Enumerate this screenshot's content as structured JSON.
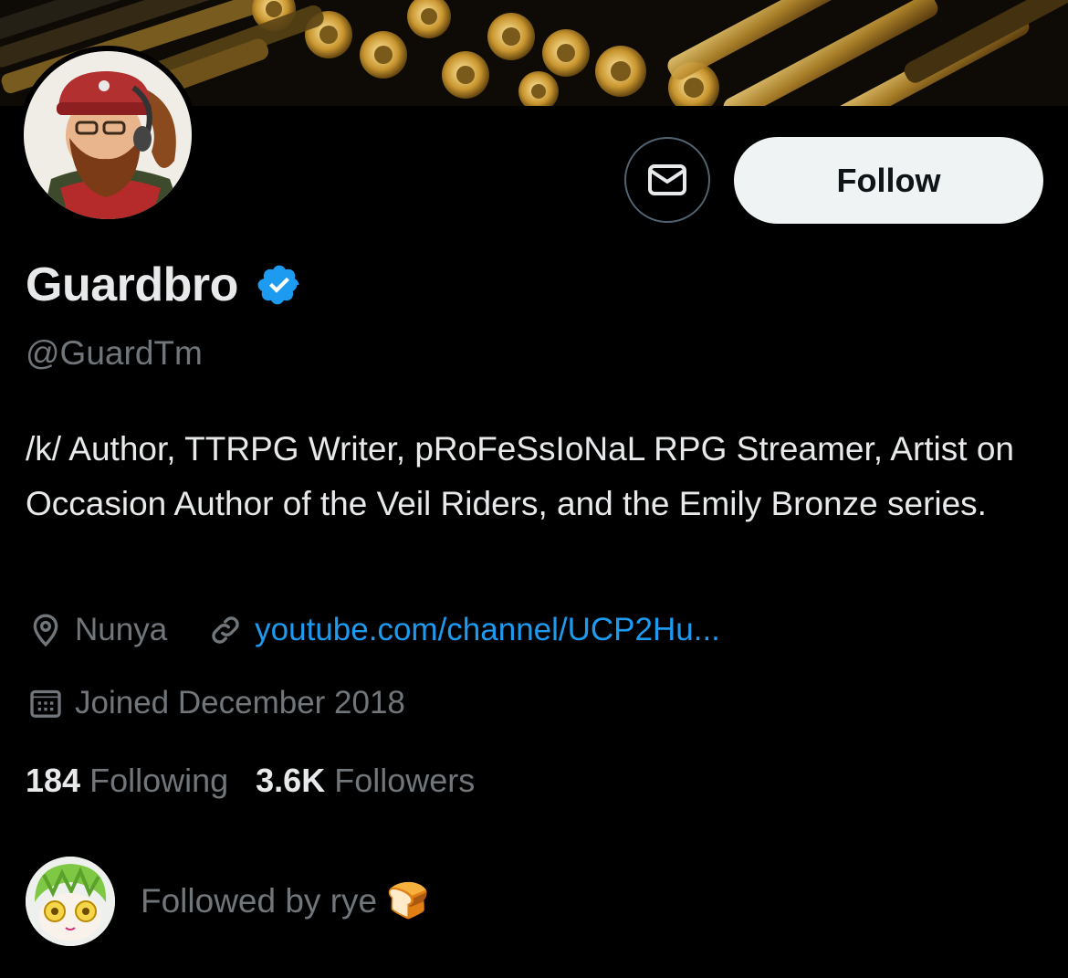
{
  "profile": {
    "display_name": "Guardbro",
    "handle": "@GuardTm",
    "verified": true,
    "bio": "/k/ Author, TTRPG Writer, pRoFeSsIoNaL RPG Streamer, Artist on Occasion Author of the Veil Riders, and the Emily Bronze series.",
    "location": "Nunya",
    "website": "youtube.com/channel/UCP2Hu...",
    "joined": "Joined December 2018"
  },
  "actions": {
    "follow_label": "Follow"
  },
  "stats": {
    "following_count": "184",
    "following_label": "Following",
    "followers_count": "3.6K",
    "followers_label": "Followers"
  },
  "followed_by": {
    "text": "Followed by rye",
    "emoji": "🍞"
  },
  "colors": {
    "background": "#000000",
    "text_primary": "#e7e9ea",
    "text_secondary": "#71767b",
    "link": "#1d9bf0",
    "verified_badge": "#1d9bf0",
    "follow_button_bg": "#eff3f4"
  },
  "icons": [
    "envelope-icon",
    "verified-badge-icon",
    "location-pin-icon",
    "link-icon",
    "calendar-icon"
  ]
}
